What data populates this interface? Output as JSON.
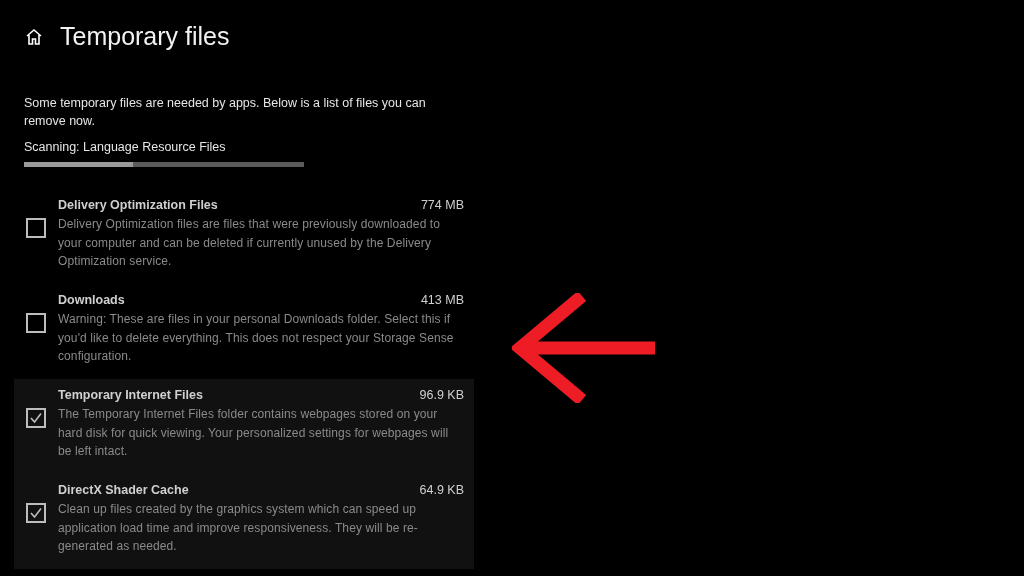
{
  "header": {
    "title": "Temporary files"
  },
  "intro": "Some temporary files are needed by apps. Below is a list of files you can remove now.",
  "scan": {
    "label": "Scanning: Language Resource Files",
    "level": 0.39
  },
  "items": [
    {
      "name": "Delivery Optimization Files",
      "size": "774 MB",
      "description": "Delivery Optimization files are files that were previously downloaded to your computer and can be deleted if currently unused by the Delivery Optimization service.",
      "checked": false
    },
    {
      "name": "Downloads",
      "size": "413 MB",
      "description": "Warning: These are files in your personal Downloads folder. Select this if you'd like to delete everything. This does not respect your Storage Sense configuration.",
      "checked": false
    },
    {
      "name": "Temporary Internet Files",
      "size": "96.9 KB",
      "description": "The Temporary Internet Files folder contains webpages stored on your hard disk for quick viewing. Your personalized settings for webpages will be left intact.",
      "checked": true
    },
    {
      "name": "DirectX Shader Cache",
      "size": "64.9 KB",
      "description": "Clean up files created by the graphics system which can speed up application load time and improve responsiveness. They will be re-generated as needed.",
      "checked": true
    }
  ]
}
